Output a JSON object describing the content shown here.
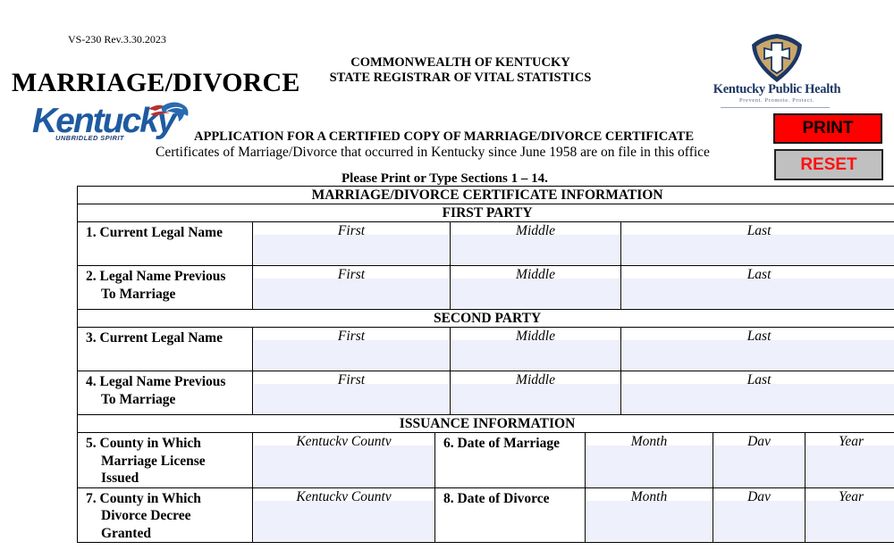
{
  "header": {
    "form_number": "VS-230 Rev.3.30.2023",
    "main_title": "MARRIAGE/DIVORCE",
    "agency_line1": "COMMONWEALTH OF KENTUCKY",
    "agency_line2": "STATE REGISTRAR OF VITAL STATISTICS",
    "state_logo": {
      "word": "Kentucky",
      "tagline": "UNBRIDLED SPIRIT",
      "icon": "horse-icon"
    },
    "health_logo": {
      "name": "Kentucky Public Health",
      "tagline": "Prevent. Promote. Protect.",
      "icon": "shield-cross-icon"
    },
    "application_title": "APPLICATION FOR A CERTIFIED COPY OF MARRIAGE/DIVORCE CERTIFICATE",
    "application_subtitle": "Certificates of Marriage/Divorce that occurred in Kentucky since June 1958 are on file in this office",
    "instructions": "Please Print or Type Sections 1 – 14."
  },
  "buttons": {
    "print": "PRINT",
    "reset": "RESET",
    "print_color": "#ff0000",
    "reset_color": "#c0c0c0",
    "reset_text_color": "#ff1111"
  },
  "form": {
    "section_title": "MARRIAGE/DIVORCE CERTIFICATE INFORMATION",
    "first_party": {
      "heading": "FIRST PARTY",
      "rows": [
        {
          "label": "1.  Current Legal Name",
          "label_cont": "",
          "fields": [
            "First",
            "Middle",
            "Last"
          ],
          "values": [
            "",
            "",
            ""
          ]
        },
        {
          "label": "2. Legal Name Previous",
          "label_cont": "To Marriage",
          "fields": [
            "First",
            "Middle",
            "Last"
          ],
          "values": [
            "",
            "",
            ""
          ]
        }
      ]
    },
    "second_party": {
      "heading": "SECOND PARTY",
      "rows": [
        {
          "label": "3.  Current Legal Name",
          "label_cont": "",
          "fields": [
            "First",
            "Middle",
            "Last"
          ],
          "values": [
            "",
            "",
            ""
          ]
        },
        {
          "label": "4. Legal Name Previous",
          "label_cont": "To Marriage",
          "fields": [
            "First",
            "Middle",
            "Last"
          ],
          "values": [
            "",
            "",
            ""
          ]
        }
      ]
    },
    "issuance": {
      "heading": "ISSUANCE INFORMATION",
      "rows": [
        {
          "county_label": "5. County in Which",
          "county_label_cont1": "Marriage License",
          "county_label_cont2": "Issued",
          "county_field": "Kentucky County",
          "county_value": "",
          "date_label": "6. Date of Marriage",
          "date_fields": [
            "Month",
            "Day",
            "Year"
          ],
          "date_values": [
            "",
            "",
            ""
          ]
        },
        {
          "county_label": "7. County in Which",
          "county_label_cont1": "Divorce Decree",
          "county_label_cont2": "Granted",
          "county_field": "Kentucky County",
          "county_value": "",
          "date_label": "8. Date of Divorce",
          "date_fields": [
            "Month",
            "Day",
            "Year"
          ],
          "date_values": [
            "",
            "",
            ""
          ]
        }
      ]
    },
    "field_fill_color": "#eef0fb"
  }
}
